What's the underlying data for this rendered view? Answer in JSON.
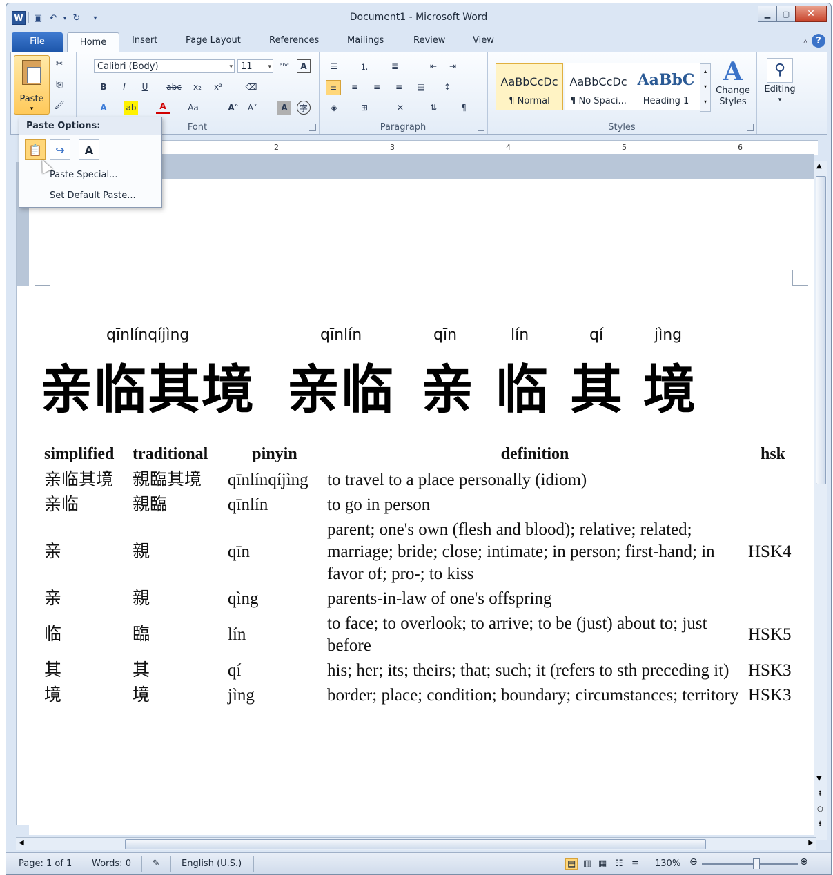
{
  "window": {
    "title": "Document1  -  Microsoft Word",
    "app_icon": "W",
    "controls": [
      "minimize-icon",
      "maximize-icon",
      "close-icon"
    ]
  },
  "quick_access": {
    "icons": [
      "save-icon",
      "undo-icon",
      "redo-icon",
      "customize-icon"
    ]
  },
  "tabs": [
    "File",
    "Home",
    "Insert",
    "Page Layout",
    "References",
    "Mailings",
    "Review",
    "View"
  ],
  "ribbon": {
    "clipboard": {
      "paste_label": "Paste"
    },
    "font": {
      "name": "Calibri (Body)",
      "size": "11",
      "label": "Font"
    },
    "paragraph": {
      "label": "Paragraph"
    },
    "styles": {
      "label": "Styles",
      "items": [
        {
          "sample": "AaBbCcDc",
          "name": "¶ Normal"
        },
        {
          "sample": "AaBbCcDc",
          "name": "¶ No Spaci..."
        },
        {
          "sample": "AaBbC",
          "name": "Heading 1"
        }
      ],
      "change_styles": "Change Styles"
    },
    "editing": {
      "label": "Editing"
    }
  },
  "ruler": {
    "marks": [
      "2",
      "3",
      "4",
      "5",
      "6"
    ]
  },
  "document": {
    "pinyin": [
      "qīnlínqíjìng",
      "qīnlín",
      "qīn",
      "lín",
      "qí",
      "jìng"
    ],
    "hanzi": [
      "亲临其境",
      "亲临",
      "亲",
      "临",
      "其",
      "境"
    ],
    "table": {
      "headers": [
        "simplified",
        "traditional",
        "pinyin",
        "definition",
        "hsk"
      ],
      "rows": [
        [
          "亲临其境",
          "親臨其境",
          "qīnlínqíjìng",
          "to travel to a place personally (idiom)",
          ""
        ],
        [
          "亲临",
          "親臨",
          "qīnlín",
          "to go in person",
          ""
        ],
        [
          "亲",
          "親",
          "qīn",
          "parent; one's own (flesh and blood); relative; related; marriage; bride; close; intimate; in person; first-hand; in favor of; pro-; to kiss",
          "HSK4"
        ],
        [
          "亲",
          "親",
          "qìng",
          "parents-in-law of one's offspring",
          ""
        ],
        [
          "临",
          "臨",
          "lín",
          "to face; to overlook; to arrive; to be (just) about to; just before",
          "HSK5"
        ],
        [
          "其",
          "其",
          "qí",
          "his; her; its; theirs; that; such; it (refers to sth preceding it)",
          "HSK3"
        ],
        [
          "境",
          "境",
          "jìng",
          "border; place; condition; boundary; circumstances; territory",
          "HSK3"
        ]
      ]
    }
  },
  "paste_popup": {
    "header": "Paste Options:",
    "menu": [
      "Paste Special...",
      "Set Default Paste..."
    ],
    "buttons": [
      "keep-source-formatting-icon",
      "merge-formatting-icon",
      "keep-text-only-icon"
    ]
  },
  "status": {
    "page": "Page: 1 of 1",
    "words": "Words: 0",
    "language": "English (U.S.)",
    "zoom": "130%"
  }
}
